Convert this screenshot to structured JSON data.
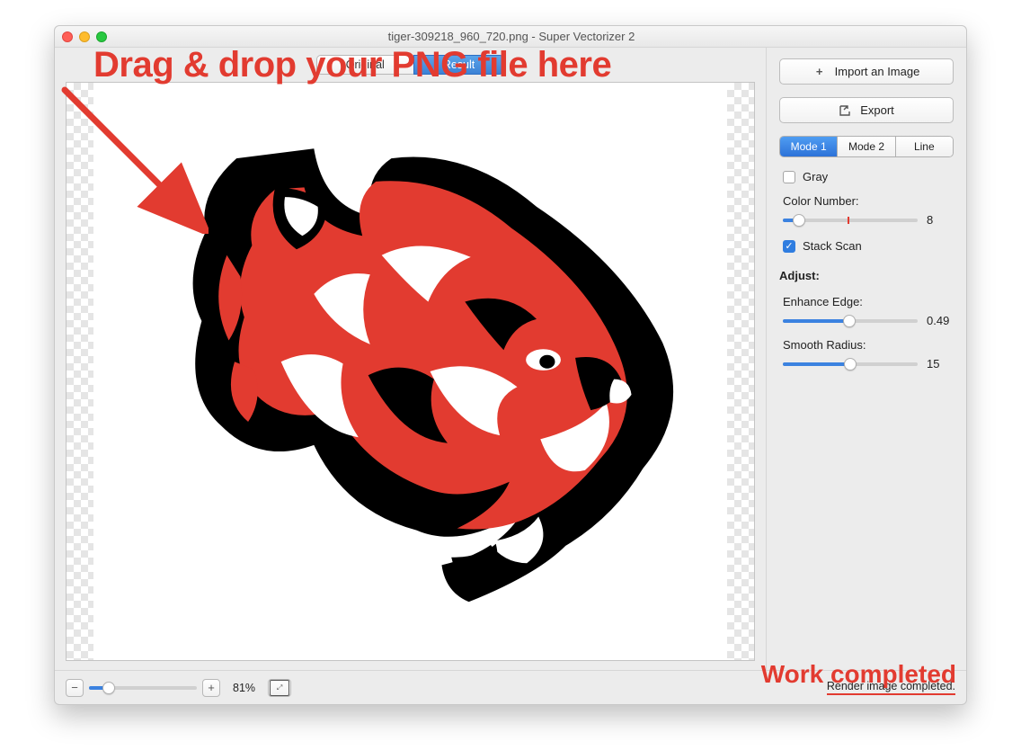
{
  "window": {
    "title": "tiger-309218_960_720.png - Super Vectorizer 2"
  },
  "tabs": {
    "original": "Original",
    "result": "Result"
  },
  "sidebar": {
    "import_label": "Import an Image",
    "export_label": "Export",
    "modes": {
      "mode1": "Mode 1",
      "mode2": "Mode 2",
      "line": "Line"
    },
    "gray_label": "Gray",
    "color_number_label": "Color Number:",
    "color_number_value": "8",
    "stack_scan_label": "Stack Scan",
    "adjust_label": "Adjust:",
    "enhance_edge_label": "Enhance Edge:",
    "enhance_edge_value": "0.49",
    "smooth_radius_label": "Smooth Radius:",
    "smooth_radius_value": "15"
  },
  "footer": {
    "zoom_pct": "81%",
    "status": "Render image completed."
  },
  "annotations": {
    "drop_hint": "Drag & drop your PNG file here",
    "work_done": "Work completed"
  }
}
